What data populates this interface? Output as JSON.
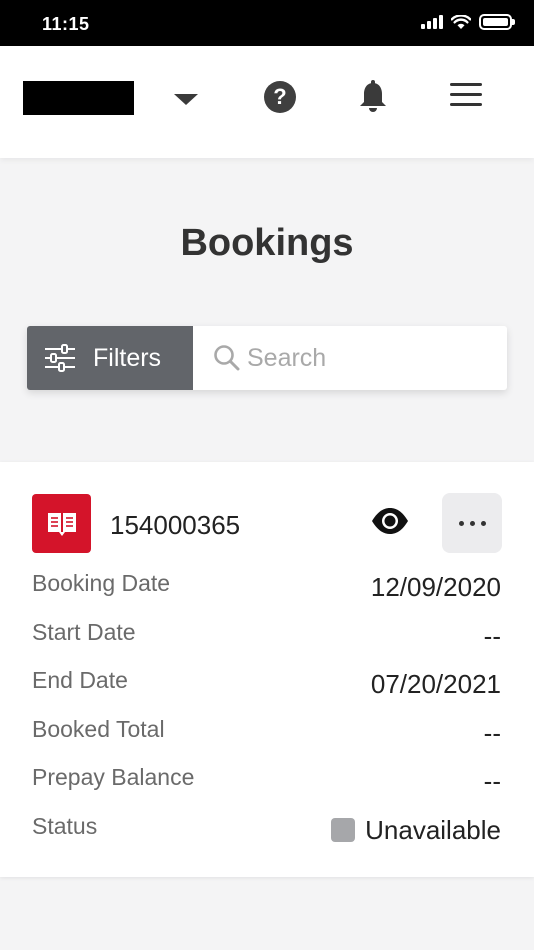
{
  "status_bar": {
    "time": "11:15"
  },
  "page": {
    "title": "Bookings"
  },
  "filter_bar": {
    "filters_label": "Filters",
    "search_placeholder": "Search"
  },
  "booking": {
    "number": "154000365",
    "badge_color": "#d4142a",
    "details": [
      {
        "label": "Booking Date",
        "value": "12/09/2020"
      },
      {
        "label": "Start Date",
        "value": "--"
      },
      {
        "label": "End Date",
        "value": "07/20/2021"
      },
      {
        "label": "Booked Total",
        "value": "--"
      },
      {
        "label": "Prepay Balance",
        "value": "--"
      },
      {
        "label": "Status",
        "value": "Unavailable",
        "status_color": "#a6a7aa"
      }
    ]
  },
  "icons": {
    "header": [
      "dropdown-caret-icon",
      "help-icon",
      "bell-icon",
      "hamburger-menu-icon"
    ],
    "filters": "sliders-icon",
    "search": "magnifier-icon",
    "booking": "book-icon",
    "view": "eye-icon",
    "more": "more-dots-icon"
  }
}
